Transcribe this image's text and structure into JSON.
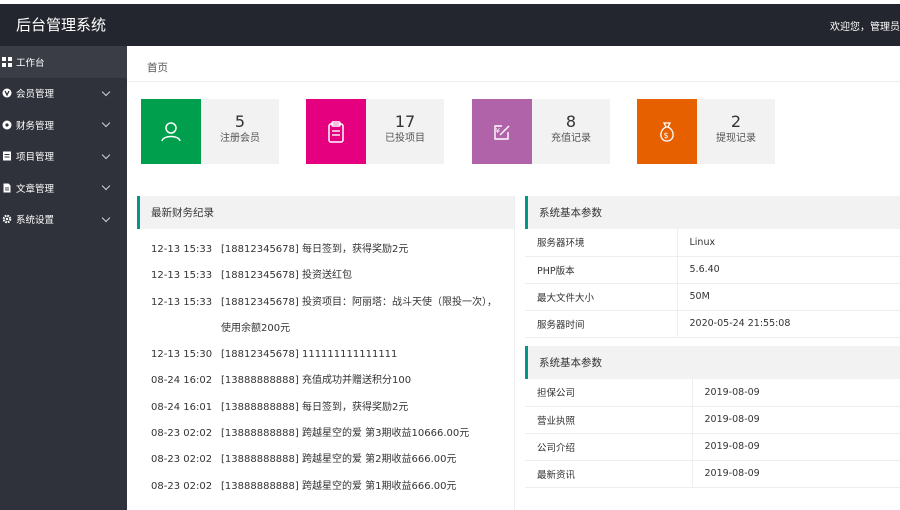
{
  "header": {
    "brand": "后台管理系统",
    "welcome": "欢迎您，管理员"
  },
  "sidebar": {
    "items": [
      {
        "label": "工作台",
        "icon": "dashboard-icon"
      },
      {
        "label": "会员管理",
        "icon": "member-icon"
      },
      {
        "label": "财务管理",
        "icon": "finance-icon"
      },
      {
        "label": "项目管理",
        "icon": "project-icon"
      },
      {
        "label": "文章管理",
        "icon": "article-icon"
      },
      {
        "label": "系统设置",
        "icon": "gear-icon"
      }
    ]
  },
  "breadcrumb": "首页",
  "stats": [
    {
      "value": "5",
      "label": "注册会员",
      "color": "#009f4d",
      "icon": "user-icon"
    },
    {
      "value": "17",
      "label": "已投项目",
      "color": "#e4007f",
      "icon": "clipboard-icon"
    },
    {
      "value": "8",
      "label": "充值记录",
      "color": "#b063a8",
      "icon": "recharge-icon"
    },
    {
      "value": "2",
      "label": "提现记录",
      "color": "#e76000",
      "icon": "money-bag-icon"
    }
  ],
  "finance": {
    "title": "最新财务纪录",
    "rows": [
      {
        "time": "12-13 15:33",
        "text": "[18812345678] 每日签到，获得奖励2元"
      },
      {
        "time": "12-13 15:33",
        "text": "[18812345678] 投资送红包"
      },
      {
        "time": "12-13 15:33",
        "text": "[18812345678] 投资项目：阿丽塔：战斗天使（限投一次），使用余额200元"
      },
      {
        "time": "12-13 15:30",
        "text": "[18812345678] 111111111111111"
      },
      {
        "time": "08-24 16:02",
        "text": "[13888888888] 充值成功并赠送积分100"
      },
      {
        "time": "08-24 16:01",
        "text": "[13888888888] 每日签到，获得奖励2元"
      },
      {
        "time": "08-23 02:02",
        "text": "[13888888888] 跨越星空的爱 第3期收益10666.00元"
      },
      {
        "time": "08-23 02:02",
        "text": "[13888888888] 跨越星空的爱 第2期收益666.00元"
      },
      {
        "time": "08-23 02:02",
        "text": "[13888888888] 跨越星空的爱 第1期收益666.00元"
      }
    ]
  },
  "system": {
    "title": "系统基本参数",
    "rows": [
      {
        "k": "服务器环境",
        "v": "Linux"
      },
      {
        "k": "PHP版本",
        "v": "5.6.40"
      },
      {
        "k": "最大文件大小",
        "v": "50M"
      },
      {
        "k": "服务器时间",
        "v": "2020-05-24 21:55:08"
      }
    ]
  },
  "company": {
    "title": "系统基本参数",
    "rows": [
      {
        "k": "担保公司",
        "v": "2019-08-09"
      },
      {
        "k": "营业执照",
        "v": "2019-08-09"
      },
      {
        "k": "公司介绍",
        "v": "2019-08-09"
      },
      {
        "k": "最新资讯",
        "v": "2019-08-09"
      }
    ]
  }
}
